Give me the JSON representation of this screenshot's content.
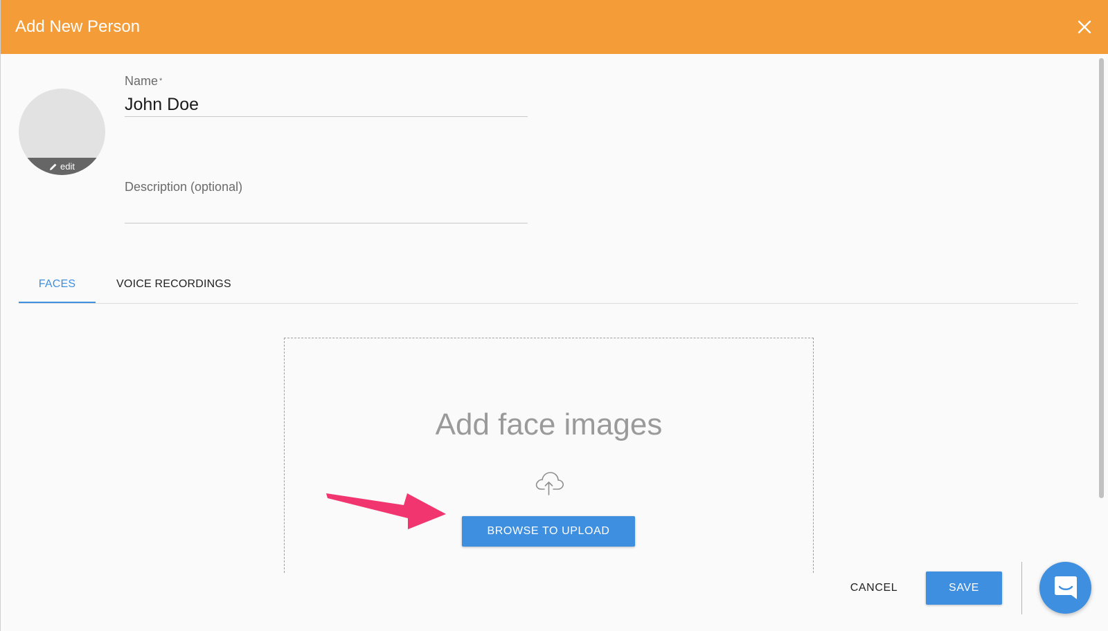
{
  "dialog": {
    "title": "Add New Person"
  },
  "avatar": {
    "edit_label": "edit"
  },
  "form": {
    "name": {
      "label": "Name",
      "required_mark": "*",
      "value": "John Doe"
    },
    "description": {
      "placeholder": "Description (optional)",
      "value": ""
    }
  },
  "tabs": [
    {
      "label": "FACES",
      "active": true
    },
    {
      "label": "VOICE RECORDINGS",
      "active": false
    }
  ],
  "dropzone": {
    "title": "Add face images",
    "icon": "cloud-upload-icon",
    "button_label": "BROWSE TO UPLOAD"
  },
  "footer": {
    "cancel_label": "CANCEL",
    "save_label": "SAVE"
  },
  "colors": {
    "header": "#f39c38",
    "accent": "#3f8fe0",
    "annotation_arrow": "#f0356f"
  }
}
